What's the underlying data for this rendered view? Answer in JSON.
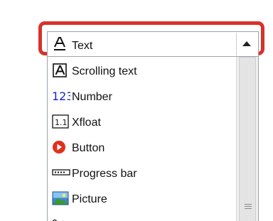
{
  "combo": {
    "selected_label": "Text",
    "icon": "text-type-icon",
    "arrow_icon": "chevron-up-icon"
  },
  "dropdown": {
    "items": [
      {
        "label": "Scrolling text",
        "icon": "scrolling-text-icon"
      },
      {
        "label": "Number",
        "icon": "number-icon"
      },
      {
        "label": "Xfloat",
        "icon": "xfloat-icon"
      },
      {
        "label": "Button",
        "icon": "button-icon"
      },
      {
        "label": "Progress bar",
        "icon": "progress-bar-icon"
      },
      {
        "label": "Picture",
        "icon": "picture-icon"
      }
    ]
  },
  "colors": {
    "highlight": "#d9312b",
    "number_icon": "#1a23c9",
    "button_icon": "#e0301e"
  }
}
